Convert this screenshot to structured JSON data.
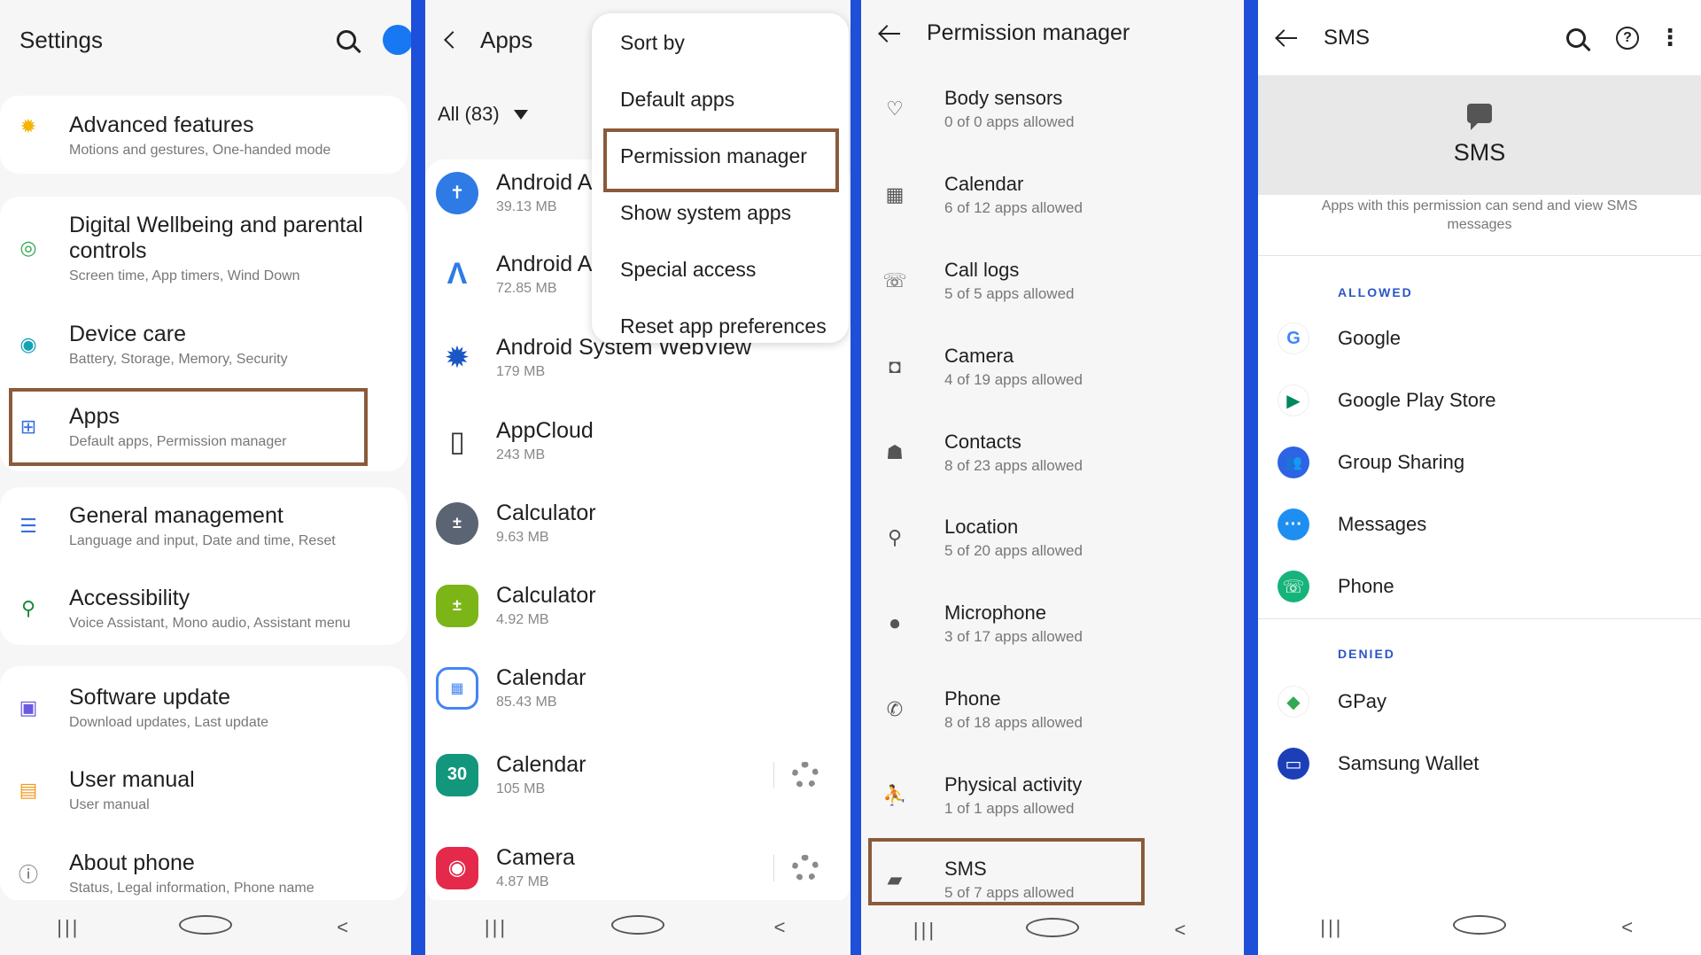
{
  "colors": {
    "divider": "#1e4fd8",
    "highlight_border": "#8b5a3a",
    "section_label": "#2a56c6"
  },
  "navbar": {
    "recent": "|||",
    "back": "<"
  },
  "screen1": {
    "title": "Settings",
    "items": [
      {
        "title": "Advanced features",
        "subtitle": "Motions and gestures, One-handed mode",
        "icon": "gear-star-icon"
      },
      {
        "title": "Digital Wellbeing and parental controls",
        "subtitle": "Screen time, App timers, Wind Down",
        "icon": "wellbeing-icon"
      },
      {
        "title": "Device care",
        "subtitle": "Battery, Storage, Memory, Security",
        "icon": "device-care-icon"
      },
      {
        "title": "Apps",
        "subtitle": "Default apps, Permission manager",
        "icon": "apps-grid-icon"
      },
      {
        "title": "General management",
        "subtitle": "Language and input, Date and time, Reset",
        "icon": "sliders-icon"
      },
      {
        "title": "Accessibility",
        "subtitle": "Voice Assistant, Mono audio, Assistant menu",
        "icon": "accessibility-icon"
      },
      {
        "title": "Software update",
        "subtitle": "Download updates, Last update",
        "icon": "software-update-icon"
      },
      {
        "title": "User manual",
        "subtitle": "User manual",
        "icon": "manual-icon"
      },
      {
        "title": "About phone",
        "subtitle": "Status, Legal information, Phone name",
        "icon": "info-icon"
      }
    ]
  },
  "screen2": {
    "title": "Apps",
    "filter": "All (83)",
    "apps": [
      {
        "name": "Android A",
        "size": "39.13 MB",
        "icon": "android-accessibility-icon"
      },
      {
        "name": "Android A",
        "size": "72.85 MB",
        "icon": "android-auto-icon"
      },
      {
        "name": "Android System WebView",
        "size": "179 MB",
        "icon": "webview-icon"
      },
      {
        "name": "AppCloud",
        "size": "243 MB",
        "icon": "appcloud-icon"
      },
      {
        "name": "Calculator",
        "size": "9.63 MB",
        "icon": "calculator-icon"
      },
      {
        "name": "Calculator",
        "size": "4.92 MB",
        "icon": "calculator-green-icon"
      },
      {
        "name": "Calendar",
        "size": "85.43 MB",
        "icon": "google-calendar-icon"
      },
      {
        "name": "Calendar",
        "size": "105 MB",
        "icon": "samsung-calendar-icon",
        "badge": "30"
      },
      {
        "name": "Camera",
        "size": "4.87 MB",
        "icon": "camera-icon"
      }
    ],
    "menu": {
      "items": [
        "Sort by",
        "Default apps",
        "Permission manager",
        "Show system apps",
        "Special access",
        "Reset app preferences"
      ]
    }
  },
  "screen3": {
    "title": "Permission manager",
    "permissions": [
      {
        "name": "Body sensors",
        "count": "0 of 0 apps allowed",
        "icon": "heart-icon"
      },
      {
        "name": "Calendar",
        "count": "6 of 12 apps allowed",
        "icon": "calendar-icon"
      },
      {
        "name": "Call logs",
        "count": "5 of 5 apps allowed",
        "icon": "call-log-icon"
      },
      {
        "name": "Camera",
        "count": "4 of 19 apps allowed",
        "icon": "camera-icon"
      },
      {
        "name": "Contacts",
        "count": "8 of 23 apps allowed",
        "icon": "contacts-icon"
      },
      {
        "name": "Location",
        "count": "5 of 20 apps allowed",
        "icon": "location-icon"
      },
      {
        "name": "Microphone",
        "count": "3 of 17 apps allowed",
        "icon": "microphone-icon"
      },
      {
        "name": "Phone",
        "count": "8 of 18 apps allowed",
        "icon": "phone-icon"
      },
      {
        "name": "Physical activity",
        "count": "1 of 1 apps allowed",
        "icon": "activity-icon"
      },
      {
        "name": "SMS",
        "count": "5 of 7 apps allowed",
        "icon": "sms-icon"
      }
    ]
  },
  "screen4": {
    "title": "SMS",
    "hero_title": "SMS",
    "description": "Apps with this permission can send and view SMS messages",
    "allowed_label": "ALLOWED",
    "denied_label": "DENIED",
    "allowed": [
      {
        "name": "Google",
        "icon": "google-icon",
        "glyph": "G"
      },
      {
        "name": "Google Play Store",
        "icon": "play-store-icon",
        "glyph": "▶"
      },
      {
        "name": "Group Sharing",
        "icon": "group-sharing-icon",
        "glyph": "👥"
      },
      {
        "name": "Messages",
        "icon": "messages-icon",
        "glyph": "···"
      },
      {
        "name": "Phone",
        "icon": "phone-app-icon",
        "glyph": "☏"
      }
    ],
    "denied": [
      {
        "name": "GPay",
        "icon": "gpay-icon",
        "glyph": "◆"
      },
      {
        "name": "Samsung Wallet",
        "icon": "samsung-wallet-icon",
        "glyph": "▭"
      }
    ]
  }
}
